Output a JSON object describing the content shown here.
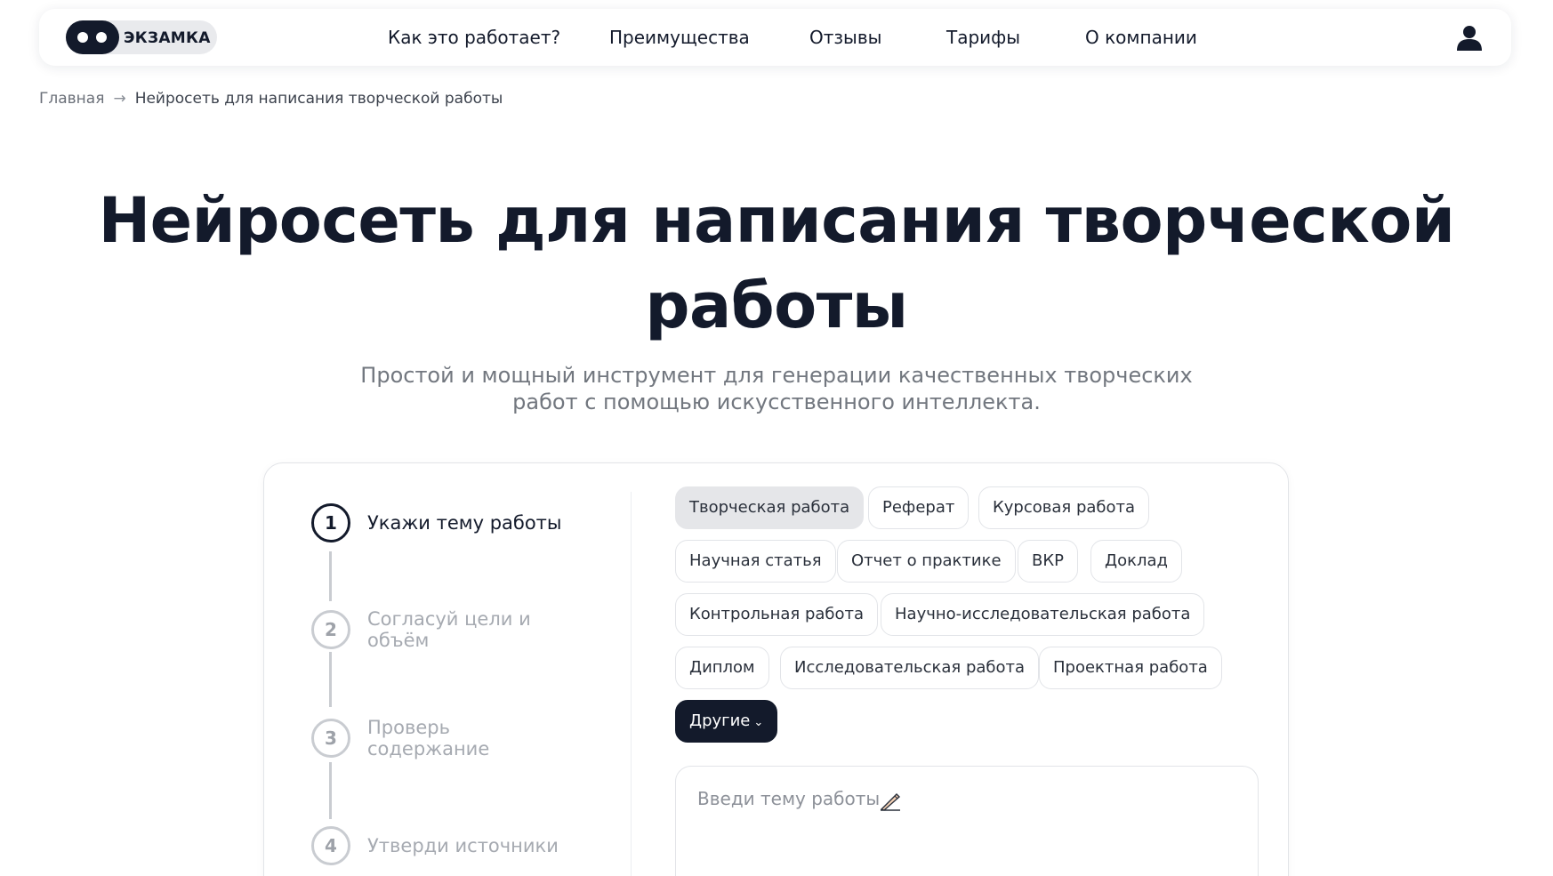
{
  "header": {
    "logo_text": "ЭКЗАМКА",
    "nav": [
      {
        "label": "Как это работает?"
      },
      {
        "label": "Преимущества"
      },
      {
        "label": "Отзывы"
      },
      {
        "label": "Тарифы"
      },
      {
        "label": "О компании"
      }
    ],
    "user_icon": "user-icon"
  },
  "breadcrumb": {
    "home": "Главная",
    "separator": "→",
    "current": "Нейросеть для написания творческой работы"
  },
  "hero": {
    "title_line1": "Нейросеть для написания творческой",
    "title_line2": "работы",
    "subtitle_line1": "Простой и мощный инструмент для генерации качественных творческих",
    "subtitle_line2": "работ с помощью искусственного интеллекта."
  },
  "steps": [
    {
      "number": "1",
      "label": "Укажи тему работы",
      "active": true
    },
    {
      "number": "2",
      "label": "Согласуй цели и объём",
      "active": false
    },
    {
      "number": "3",
      "label": "Проверь содержание",
      "active": false
    },
    {
      "number": "4",
      "label": "Утверди источники",
      "active": false
    }
  ],
  "work_types": {
    "selected": "Творческая работа",
    "chips": [
      "Творческая работа",
      "Реферат",
      "Курсовая работа",
      "Научная статья",
      "Отчет о практике",
      "ВКР",
      "Доклад",
      "Контрольная работа",
      "Научно-исследовательская работа",
      "Диплом",
      "Исследовательская работа",
      "Проектная работа"
    ],
    "more_label": "Другие"
  },
  "topic_input": {
    "placeholder": "Введи тему работы",
    "value": "",
    "icon": "writing-hand-icon"
  },
  "colors": {
    "primary_dark": "#131a2b",
    "selected_chip_bg": "#e5e6e9",
    "muted_text": "#72777f",
    "inactive_step": "#c9ccd1"
  }
}
